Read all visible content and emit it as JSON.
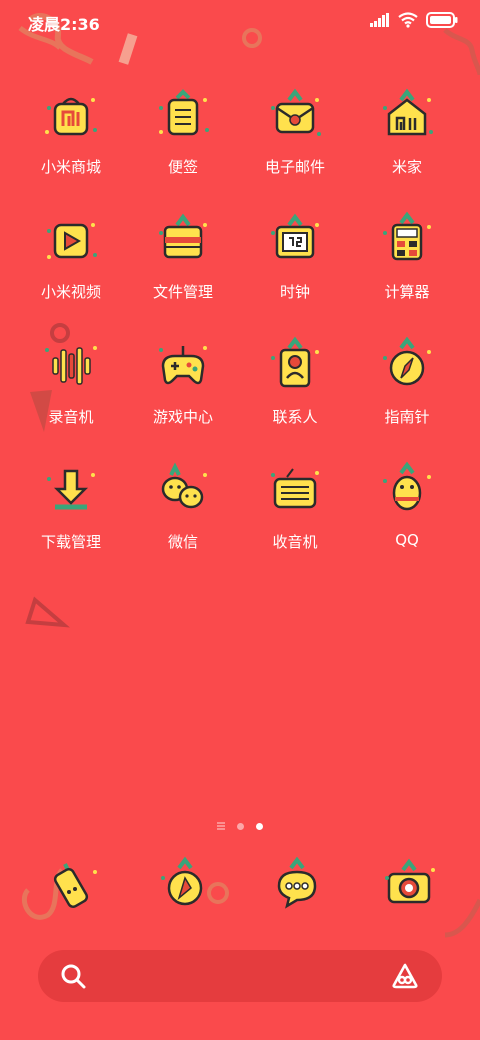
{
  "status_bar": {
    "time": "凌晨2:36",
    "icons": [
      "signal-icon",
      "wifi-icon",
      "battery-icon"
    ]
  },
  "apps": [
    {
      "label": "小米商城",
      "icon": "mi-store-icon"
    },
    {
      "label": "便签",
      "icon": "notes-icon"
    },
    {
      "label": "电子邮件",
      "icon": "email-icon"
    },
    {
      "label": "米家",
      "icon": "mijia-icon"
    },
    {
      "label": "小米视频",
      "icon": "mi-video-icon"
    },
    {
      "label": "文件管理",
      "icon": "file-manager-icon"
    },
    {
      "label": "时钟",
      "icon": "clock-icon"
    },
    {
      "label": "计算器",
      "icon": "calculator-icon"
    },
    {
      "label": "录音机",
      "icon": "recorder-icon"
    },
    {
      "label": "游戏中心",
      "icon": "game-center-icon"
    },
    {
      "label": "联系人",
      "icon": "contacts-icon"
    },
    {
      "label": "指南针",
      "icon": "compass-icon"
    },
    {
      "label": "下载管理",
      "icon": "downloads-icon"
    },
    {
      "label": "微信",
      "icon": "wechat-icon"
    },
    {
      "label": "收音机",
      "icon": "radio-icon"
    },
    {
      "label": "QQ",
      "icon": "qq-icon"
    }
  ],
  "page_indicator": {
    "pages": 3,
    "current": 3
  },
  "dock": [
    {
      "icon": "phone-icon"
    },
    {
      "icon": "browser-icon"
    },
    {
      "icon": "messages-icon"
    },
    {
      "icon": "camera-icon"
    }
  ],
  "search_bar": {
    "icons": [
      "search-icon",
      "assistant-icon"
    ]
  },
  "colors": {
    "background": "#fa4a4c",
    "icon_fill": "#ffe14d",
    "outline": "#2b2b2b",
    "leaf": "#3aa57a",
    "search_bg": "#e53c3e"
  }
}
